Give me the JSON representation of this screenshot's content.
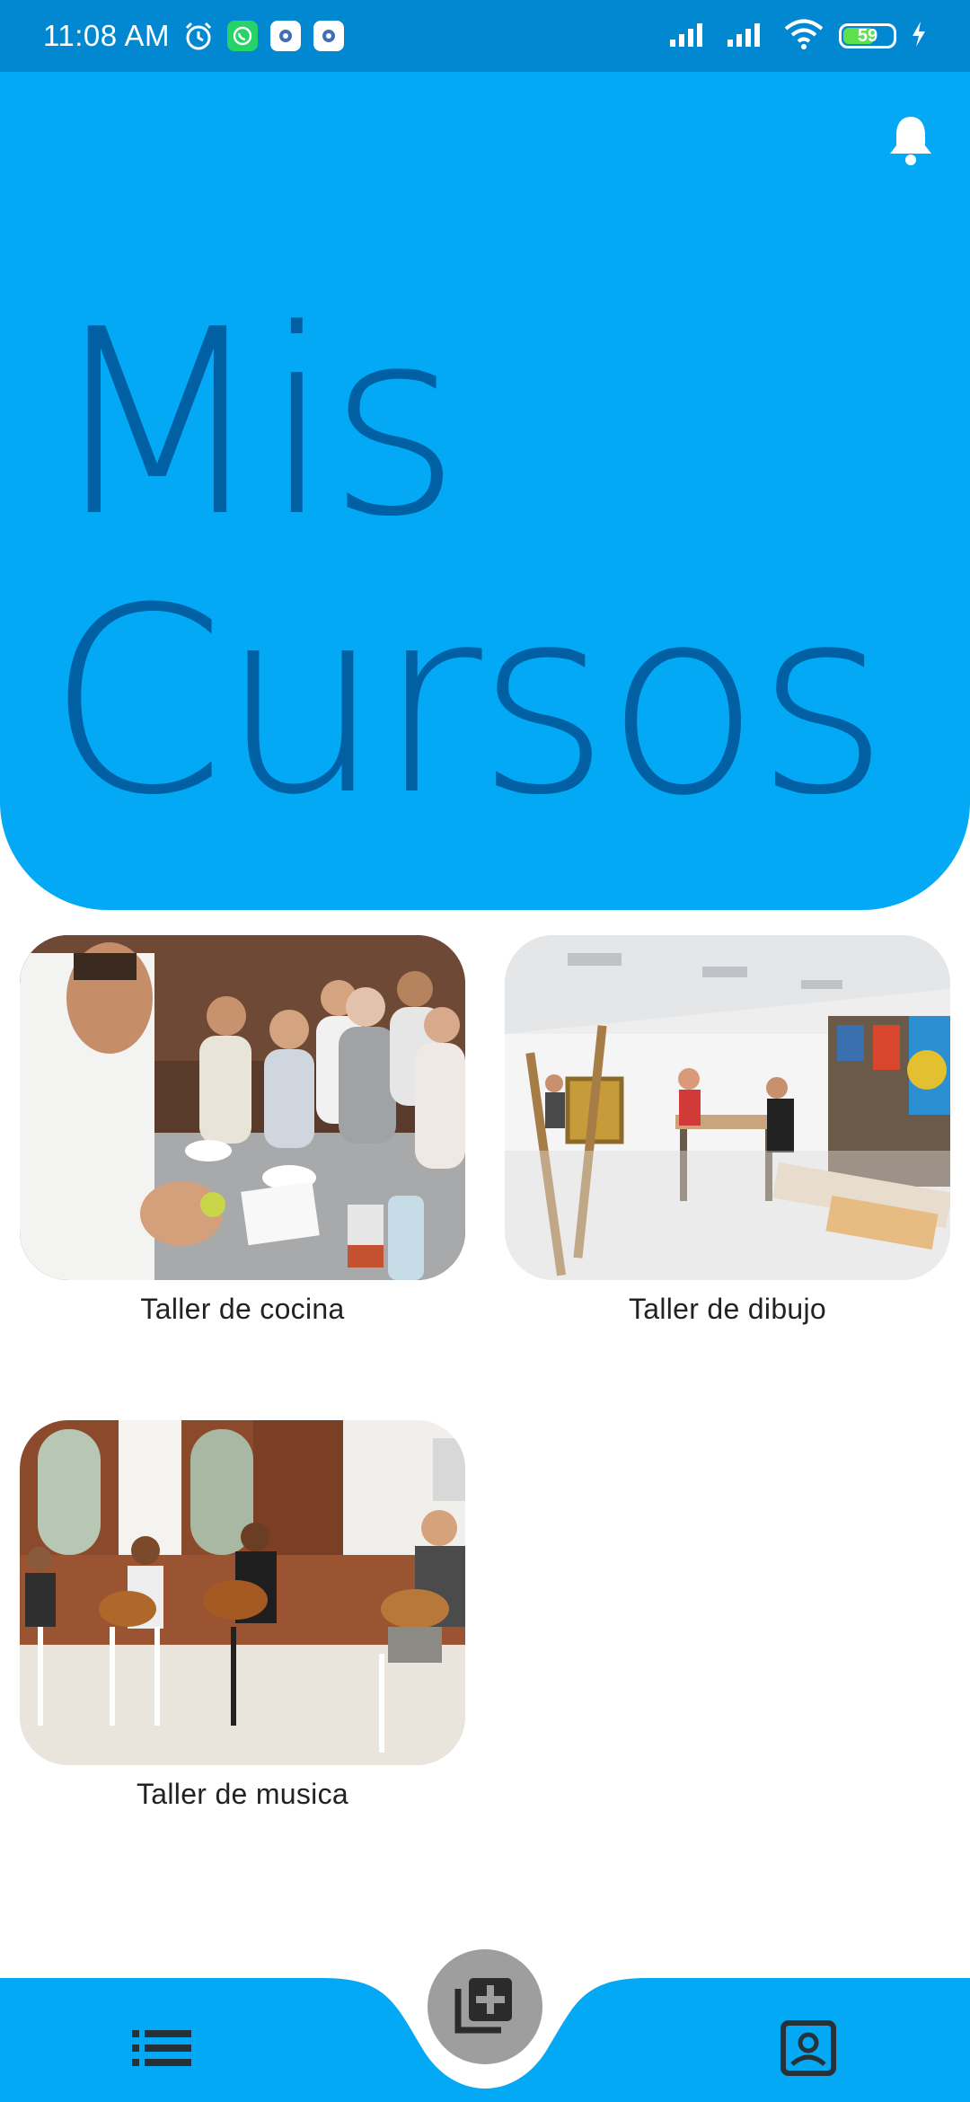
{
  "status_bar": {
    "time": "11:08 AM",
    "battery_level": "59",
    "icons": [
      "alarm-icon",
      "whatsapp-icon",
      "settings-icon",
      "settings-icon",
      "signal-icon",
      "signal-icon",
      "wifi-icon",
      "battery-icon",
      "charging-icon"
    ]
  },
  "header": {
    "title_line_1": "Mis",
    "title_line_2": "Cursos",
    "notification_icon": "bell-icon",
    "background_color": "#03a9f4",
    "title_color": "#01579b"
  },
  "courses": [
    {
      "label": "Taller de cocina"
    },
    {
      "label": "Taller de dibujo"
    },
    {
      "label": "Taller de musica"
    }
  ],
  "bottom_nav": {
    "left_icon": "list-icon",
    "center_icon": "add-library-icon",
    "right_icon": "contact-card-icon",
    "background_color": "#03a9f4"
  }
}
